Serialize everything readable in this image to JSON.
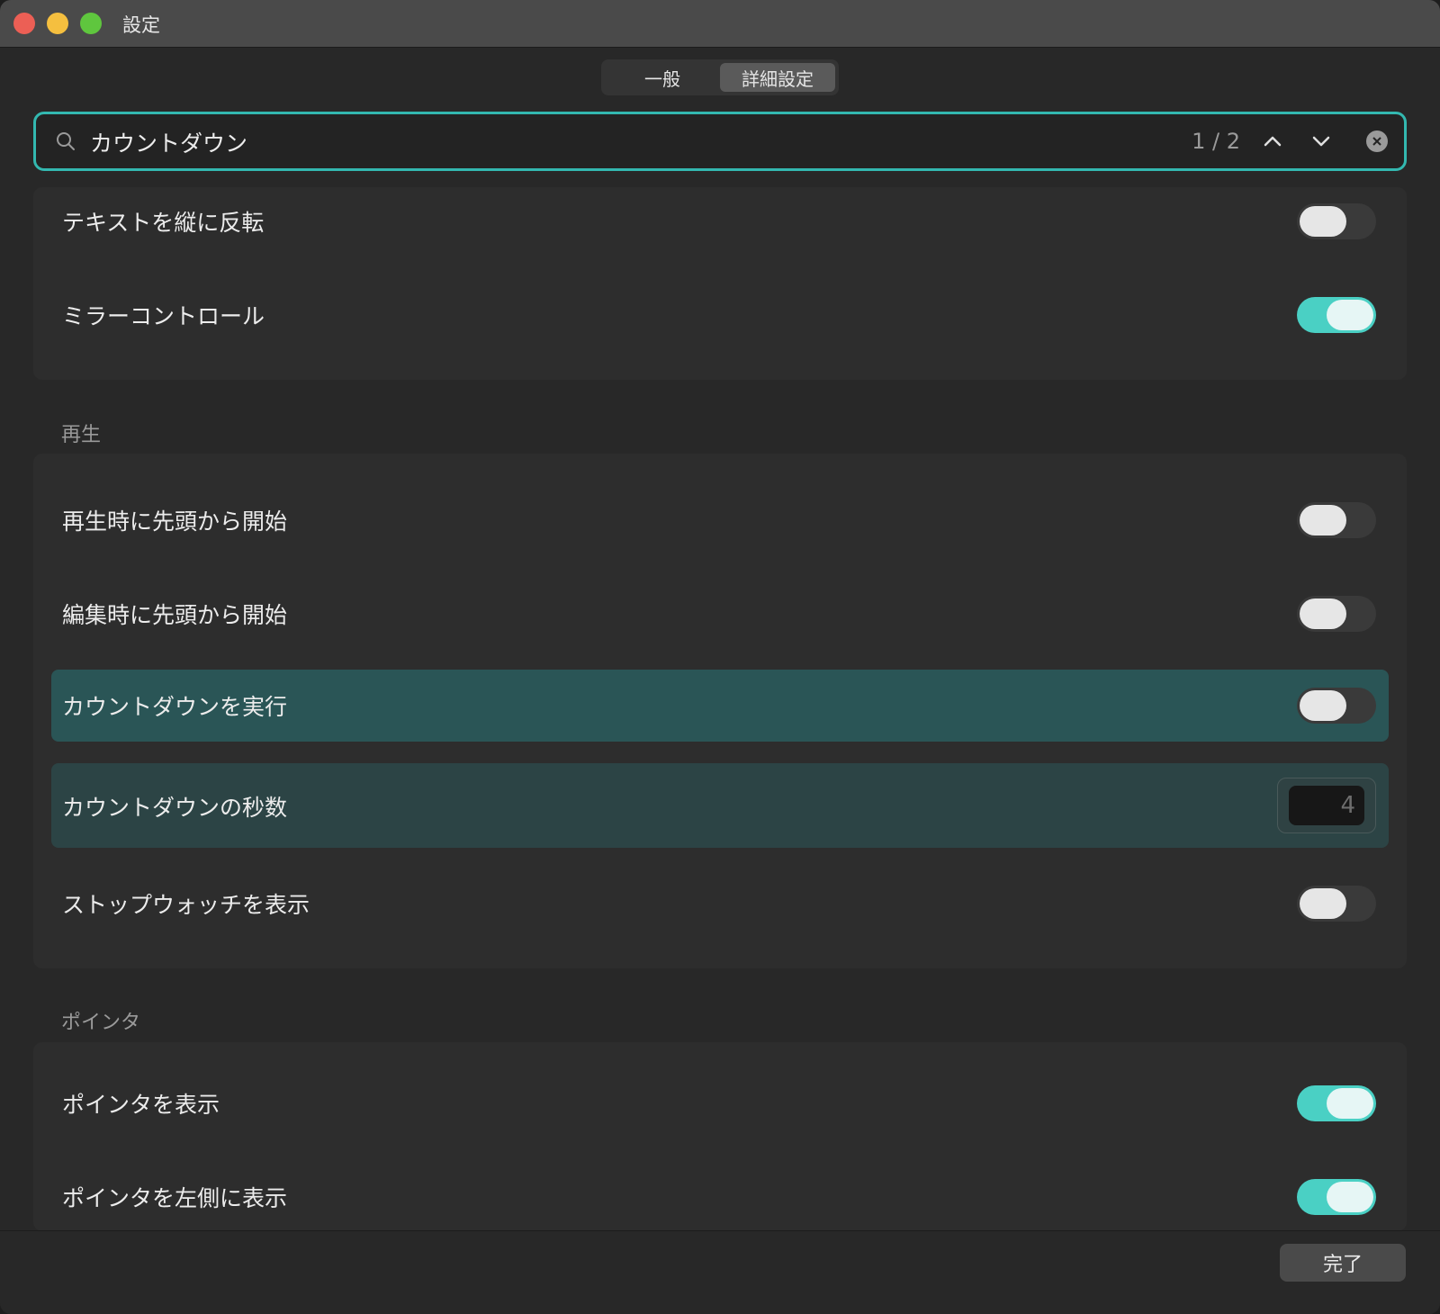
{
  "window": {
    "title": "設定"
  },
  "tabs": [
    {
      "label": "一般",
      "active": false
    },
    {
      "label": "詳細設定",
      "active": true
    }
  ],
  "search": {
    "value": "カウントダウン",
    "match_count": "1 / 2"
  },
  "sections": {
    "display": {
      "rows": [
        {
          "label": "テキストを縦に反転",
          "on": false
        },
        {
          "label": "ミラーコントロール",
          "on": true
        }
      ]
    },
    "playback": {
      "title": "再生",
      "rows": [
        {
          "label": "再生時に先頭から開始",
          "on": false
        },
        {
          "label": "編集時に先頭から開始",
          "on": false
        },
        {
          "label": "カウントダウンを実行",
          "on": false
        },
        {
          "label": "カウントダウンの秒数",
          "value": "4"
        },
        {
          "label": "ストップウォッチを表示",
          "on": false
        }
      ]
    },
    "pointer": {
      "title": "ポインタ",
      "rows": [
        {
          "label": "ポインタを表示",
          "on": true
        },
        {
          "label": "ポインタを左側に表示",
          "on": true
        }
      ]
    }
  },
  "footer": {
    "done_label": "完了"
  },
  "colors": {
    "accent": "#4ad0c4",
    "highlight": "#2a5556",
    "search_border": "#33b8b0"
  }
}
